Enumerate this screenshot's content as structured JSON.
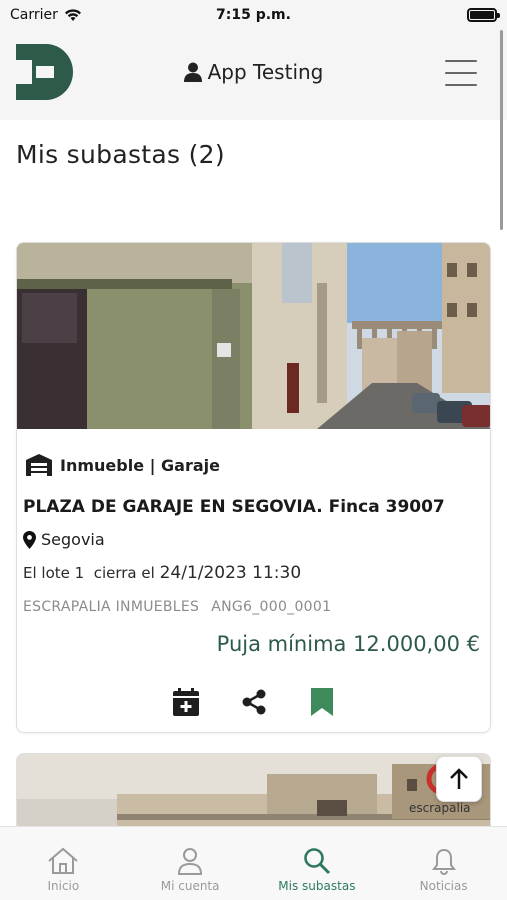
{
  "status_bar": {
    "carrier": "Carrier",
    "time": "7:15 p.m."
  },
  "header": {
    "user_label": "App Testing"
  },
  "page": {
    "title": "Mis subastas (2)"
  },
  "cards": [
    {
      "category": "Inmueble | Garaje",
      "title": "PLAZA DE GARAJE EN SEGOVIA. Finca 39007",
      "location": "Segovia",
      "closing_prefix": "El lote 1  cierra el",
      "closing_date": "24/1/2023 11:30",
      "seller": "ESCRAPALIA INMUEBLES",
      "reference": "ANG6_000_0001",
      "price": "Puja mínima 12.000,00 €",
      "actions": [
        "calendar-add-icon",
        "share-icon",
        "bookmark-icon"
      ]
    },
    {
      "watermark": "escrapalia"
    }
  ],
  "tabs": [
    {
      "label": "Inicio",
      "icon": "home-icon",
      "active": false
    },
    {
      "label": "Mi cuenta",
      "icon": "user-icon",
      "active": false
    },
    {
      "label": "Mis subastas",
      "icon": "search-icon",
      "active": true
    },
    {
      "label": "Noticias",
      "icon": "bell-icon",
      "active": false
    }
  ],
  "colors": {
    "brand_green": "#2e5a49",
    "active_tab": "#2e7a5e",
    "bookmark_green": "#3e8a5a"
  }
}
